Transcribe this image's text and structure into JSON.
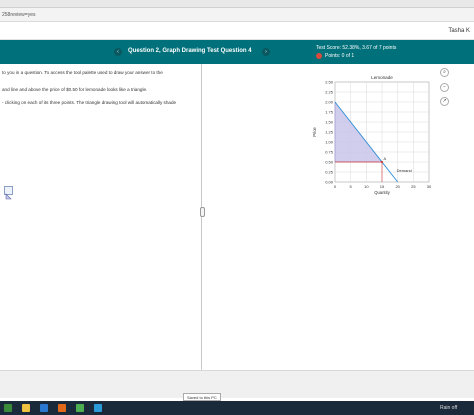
{
  "browser": {
    "url_text": "258review=yes",
    "user_name": "Tasha K"
  },
  "header": {
    "question_title": "Question 2, Graph Drawing Test Question 4",
    "prev_label": "‹",
    "next_label": "›",
    "test_score": "Test Score: 52.38%, 3.67 of 7 points",
    "points": "Points: 0 of 1"
  },
  "instructions": {
    "line1": "to you in a question. To access the tool palette used to draw your answer to the",
    "line2": "and line and above the price of $0.50 for lemonade looks like a triangle.",
    "line3": "- clicking on each of its three points. The triangle drawing tool will automatically shade"
  },
  "chart_data": {
    "type": "line",
    "title": "Lemonade",
    "xlabel": "Quantity",
    "ylabel": "Price",
    "xlim": [
      0,
      30
    ],
    "ylim": [
      0,
      2.5
    ],
    "x_ticks": [
      "0",
      "5",
      "10",
      "15",
      "20",
      "25",
      "30"
    ],
    "y_ticks": [
      "0.00",
      "0.25",
      "0.50",
      "0.75",
      "1.00",
      "1.25",
      "1.50",
      "1.75",
      "2.00",
      "2.25",
      "2.50"
    ],
    "grid": true,
    "series": [
      {
        "name": "Demand",
        "x": [
          0,
          20
        ],
        "y": [
          2.0,
          0.0
        ]
      }
    ],
    "price_line": {
      "y": 0.5,
      "x": [
        0,
        15
      ]
    },
    "point": {
      "label": "A",
      "x": 15,
      "y": 0.5
    },
    "shaded_triangle": {
      "x": [
        0,
        0,
        15
      ],
      "y": [
        2.0,
        0.5,
        0.5
      ]
    }
  },
  "side_icons": [
    "search-icon",
    "zoom-out-icon",
    "popout-icon"
  ],
  "footer": {
    "saved_text": "Saved to this PC",
    "weather": "Rain off"
  },
  "colors": {
    "header": "#00707a",
    "demand": "#2f8fd8",
    "price": "#d23a3a",
    "shade": "#c8c4ea"
  }
}
